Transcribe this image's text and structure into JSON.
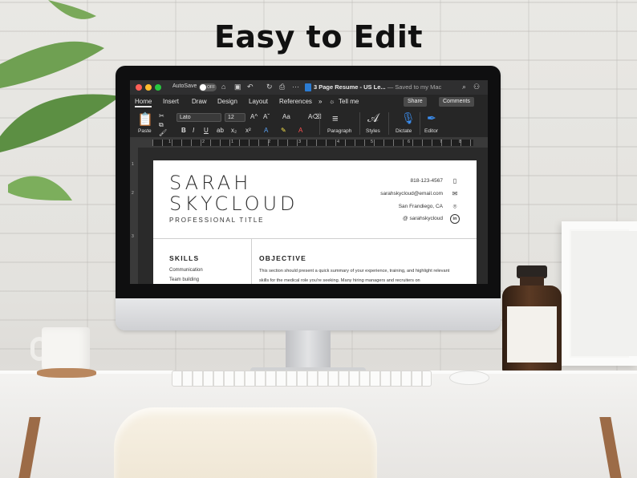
{
  "headline": "Easy to Edit",
  "window": {
    "autosave_label": "AutoSave",
    "autosave_state": "OFF",
    "doc_title": "3 Page Resume - US Le...",
    "saved_status": "— Saved to my Mac"
  },
  "menu": {
    "items": [
      "Home",
      "Insert",
      "Draw",
      "Design",
      "Layout",
      "References"
    ],
    "more": "»",
    "tell_me": "Tell me",
    "share": "Share",
    "comments": "Comments"
  },
  "ribbon": {
    "paste": "Paste",
    "font": "Lato",
    "size": "12",
    "format_buttons": [
      "B",
      "I",
      "U"
    ],
    "paragraph": "Paragraph",
    "styles": "Styles",
    "dictate": "Dictate",
    "editor": "Editor"
  },
  "ruler": {
    "numbers": [
      "1",
      "2",
      "1",
      "2",
      "3",
      "4",
      "5",
      "6",
      "7",
      "8"
    ],
    "vertical_numbers": [
      "1",
      "2",
      "3"
    ]
  },
  "resume": {
    "first_name": "SARAH",
    "last_name": "SKYCLOUD",
    "professional_title": "PROFESSIONAL TITLE",
    "phone": "818-123-4567",
    "email": "sarahskycloud@email.com",
    "location": "San Frandiego, CA",
    "linkedin": "@ sarahskycloud",
    "skills_heading": "SKILLS",
    "skills": [
      "Communication",
      "Team building"
    ],
    "objective_heading": "OBJECTIVE",
    "objective_text": "This section should present a quick summary of your experience, training, and highlight relevant skills for the medical role you're seeking. Many hiring managers and recruiters on"
  },
  "icons": {
    "phone": "phone-icon",
    "email": "envelope-icon",
    "location": "location-pin-icon",
    "linkedin": "linkedin-icon"
  },
  "colors": {
    "accent_word_blue": "#2b7cd3",
    "window_dark": "#262626",
    "traffic_red": "#fe5f57",
    "traffic_yellow": "#febc2e",
    "traffic_green": "#28c840"
  }
}
